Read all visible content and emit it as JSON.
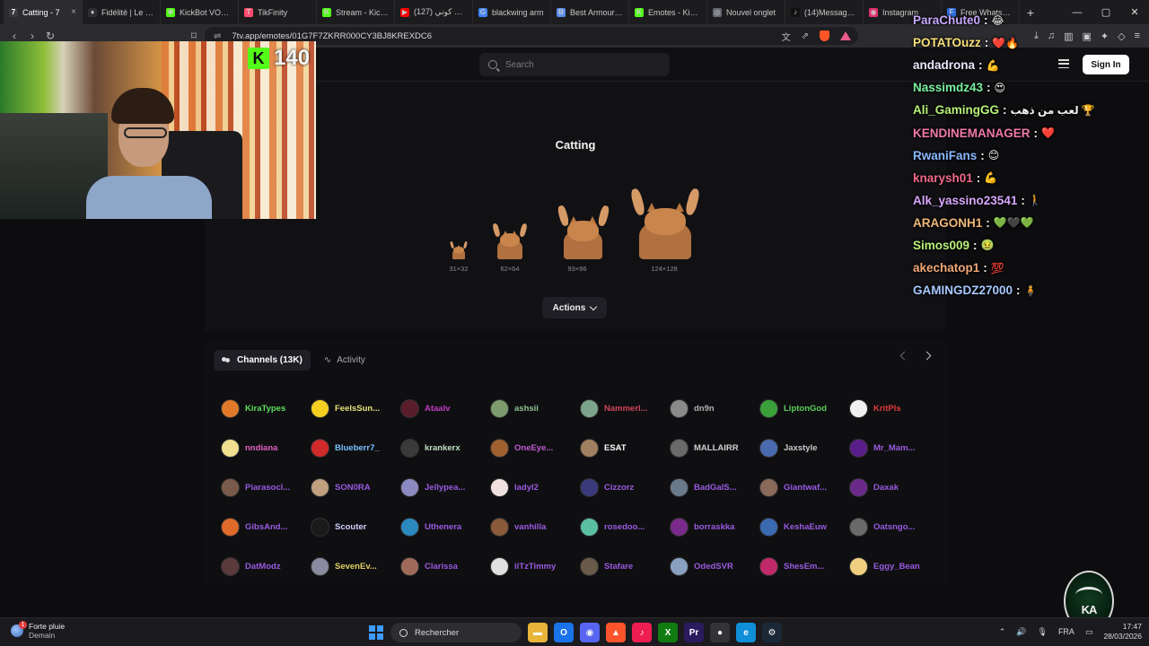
{
  "browser": {
    "tabs": [
      {
        "label": "Catting - 7",
        "color": "#3a3a3f",
        "glyph": "7"
      },
      {
        "label": "Fidélité | Le me",
        "color": "#2d2d33",
        "glyph": "♦"
      },
      {
        "label": "KickBot VOD Ed",
        "color": "#53fc18",
        "glyph": "✱"
      },
      {
        "label": "TikFinity",
        "color": "#ff4d6d",
        "glyph": "T"
      },
      {
        "label": "Stream - Kick D",
        "color": "#53fc18",
        "glyph": "K"
      },
      {
        "label": "(127) كوني كوني",
        "color": "#ff0000",
        "glyph": "▶"
      },
      {
        "label": "blackwing arm",
        "color": "#4285f4",
        "glyph": "G"
      },
      {
        "label": "Best Armour in",
        "color": "#5b8def",
        "glyph": "B"
      },
      {
        "label": "Emotes - Kick D",
        "color": "#53fc18",
        "glyph": "K"
      },
      {
        "label": "Nouvel onglet",
        "color": "#666a70",
        "glyph": "◎"
      },
      {
        "label": "(14)Messages |",
        "color": "#111111",
        "glyph": "♪"
      },
      {
        "label": "Instagram",
        "color": "#e1306c",
        "glyph": "◉"
      },
      {
        "label": "Free WhatsApp",
        "color": "#2f6fe0",
        "glyph": "F"
      }
    ],
    "active_tab_close": "×",
    "new_tab": "+",
    "url": "7tv.app/emotes/01G7F7ZKRR000CY3BJ8KREXDC6"
  },
  "site": {
    "search_placeholder": "Search",
    "signin_label": "Sign In"
  },
  "emote": {
    "title": "Catting",
    "sizes": [
      {
        "label": "31×32",
        "w": 31,
        "h": 32
      },
      {
        "label": "62×64",
        "w": 62,
        "h": 64
      },
      {
        "label": "93×96",
        "w": 93,
        "h": 96
      },
      {
        "label": "124×128",
        "w": 124,
        "h": 128
      }
    ],
    "actions_label": "Actions"
  },
  "channels": {
    "tab_channels": "Channels (13K)",
    "tab_activity": "Activity",
    "rows": [
      [
        {
          "name": "KiraTypes",
          "color": "#5ce05c",
          "av": "#e07a2a"
        },
        {
          "name": "FeelsSun...",
          "color": "#e8e07a",
          "av": "#f5d020"
        },
        {
          "name": "Ataalv",
          "color": "#c03ac0",
          "av": "#5a1e2a"
        },
        {
          "name": "ashsii",
          "color": "#8ec08e",
          "av": "#7c9c6e"
        },
        {
          "name": "Nammerl...",
          "color": "#d0455a",
          "av": "#7ca48a"
        },
        {
          "name": "dn9n",
          "color": "#b0b0b0",
          "av": "#8a8a8a"
        },
        {
          "name": "LiptonGod",
          "color": "#5cd05c",
          "av": "#3aa03a"
        },
        {
          "name": "KritPls",
          "color": "#e03a3a",
          "av": "#f0f0f0"
        }
      ],
      [
        {
          "name": "nndiana",
          "color": "#e060c0",
          "av": "#f0e090"
        },
        {
          "name": "Blueberr7_",
          "color": "#7ac0ff",
          "av": "#d02a2a"
        },
        {
          "name": "krankerx",
          "color": "#c0e0c0",
          "av": "#3a3a3a"
        },
        {
          "name": "OneEye...",
          "color": "#c05ad0",
          "av": "#a06030"
        },
        {
          "name": "ESAT",
          "color": "#ffffff",
          "av": "#a08060"
        },
        {
          "name": "MALLAIRR",
          "color": "#d0d0d0",
          "av": "#6a6a6a"
        },
        {
          "name": "Jaxstyle",
          "color": "#c8c8c8",
          "av": "#4a6ab0"
        },
        {
          "name": "Mr_Mam...",
          "color": "#9a5ae0",
          "av": "#5a1e8a"
        }
      ],
      [
        {
          "name": "Piarasocl...",
          "color": "#9a5ae0",
          "av": "#7a5a4a"
        },
        {
          "name": "SON0RA",
          "color": "#9a5ae0",
          "av": "#c0a080"
        },
        {
          "name": "Jellypea...",
          "color": "#9a5ae0",
          "av": "#8a8ac0"
        },
        {
          "name": "ladyl2",
          "color": "#9a5ae0",
          "av": "#f0e0e0"
        },
        {
          "name": "Cizzorz",
          "color": "#9a5ae0",
          "av": "#3a3a7a"
        },
        {
          "name": "BadGalS...",
          "color": "#9a5ae0",
          "av": "#6a7a8a"
        },
        {
          "name": "Giantwaf...",
          "color": "#9a5ae0",
          "av": "#8a6a5a"
        },
        {
          "name": "Daxak",
          "color": "#9a5ae0",
          "av": "#6a2a8a"
        }
      ],
      [
        {
          "name": "GibsAnd...",
          "color": "#9a5ae0",
          "av": "#e06a2a"
        },
        {
          "name": "Scouter",
          "color": "#d0d0ff",
          "av": "#1a1a1a"
        },
        {
          "name": "Uthenera",
          "color": "#9a5ae0",
          "av": "#2a8ac0"
        },
        {
          "name": "vanhilla",
          "color": "#9a5ae0",
          "av": "#8a5a3a"
        },
        {
          "name": "rosedoo...",
          "color": "#9a5ae0",
          "av": "#5ac0a0"
        },
        {
          "name": "borraskka",
          "color": "#9a5ae0",
          "av": "#7a2a8a"
        },
        {
          "name": "KeshaEuw",
          "color": "#9a5ae0",
          "av": "#3a6ab0"
        },
        {
          "name": "Oatsngo...",
          "color": "#9a5ae0",
          "av": "#6a6a6a"
        }
      ],
      [
        {
          "name": "DatModz",
          "color": "#9a5ae0",
          "av": "#5a3a3a"
        },
        {
          "name": "SevenEv...",
          "color": "#e0d060",
          "av": "#8a8aa0"
        },
        {
          "name": "Clarissa",
          "color": "#9a5ae0",
          "av": "#a06a5a"
        },
        {
          "name": "iiTzTimmy",
          "color": "#9a5ae0",
          "av": "#e0e0e0"
        },
        {
          "name": "Stafare",
          "color": "#9a5ae0",
          "av": "#6a5a4a"
        },
        {
          "name": "OdedSVR",
          "color": "#9a5ae0",
          "av": "#8aa0c0"
        },
        {
          "name": "ShesEm...",
          "color": "#9a5ae0",
          "av": "#c02a6a"
        },
        {
          "name": "Eggy_Bean",
          "color": "#9a5ae0",
          "av": "#f0d080"
        }
      ]
    ]
  },
  "stream": {
    "kick_logo": "K",
    "viewer_count": "140"
  },
  "chat": [
    {
      "user": "ParaChute0",
      "color": "#c8a8ff",
      "emote": "😂"
    },
    {
      "user": "POTATOuzz",
      "color": "#f7e07a",
      "emote": "❤️🔥"
    },
    {
      "user": "andadrona",
      "color": "#e8e8ff",
      "emote": "💪"
    },
    {
      "user": "Nassimdz43",
      "color": "#7af0a0",
      "emote": "😍"
    },
    {
      "user": "Ali_GamingGG",
      "color": "#b8f07a",
      "emote": "لعب من ذهب 🏆"
    },
    {
      "user": "KENDINEMANAGER",
      "color": "#f07aa8",
      "emote": "❤️"
    },
    {
      "user": "RwaniFans",
      "color": "#8ab8ff",
      "emote": "😊"
    },
    {
      "user": "knarysh01",
      "color": "#f06a8a",
      "emote": "💪"
    },
    {
      "user": "Alk_yassino23541",
      "color": "#d8a8ff",
      "emote": "🚶"
    },
    {
      "user": "ARAGONH1",
      "color": "#f0b878",
      "emote": "💚🖤💚"
    },
    {
      "user": "Simos009",
      "color": "#b8f07a",
      "emote": "🤢"
    },
    {
      "user": "akechatop1",
      "color": "#f0a878",
      "emote": "💯"
    },
    {
      "user": "GAMINGDZ27000",
      "color": "#a8c8ff",
      "emote": "🧍"
    }
  ],
  "taskbar": {
    "weather_title": "Forte pluie",
    "weather_sub": "Demain",
    "search_label": "Rechercher",
    "lang": "FRA",
    "time": "17:47",
    "date": "28/03/2026",
    "apps": [
      {
        "name": "files",
        "color": "#e8b43a",
        "glyph": "▬"
      },
      {
        "name": "outlook",
        "color": "#1a73e8",
        "glyph": "O"
      },
      {
        "name": "discord",
        "color": "#5865f2",
        "glyph": "◉"
      },
      {
        "name": "brave",
        "color": "#fb542b",
        "glyph": "▲"
      },
      {
        "name": "tiktok",
        "color": "#ee1d52",
        "glyph": "♪"
      },
      {
        "name": "xbox",
        "color": "#107c10",
        "glyph": "X"
      },
      {
        "name": "premiere",
        "color": "#2a1a5e",
        "glyph": "Pr"
      },
      {
        "name": "obs",
        "color": "#333336",
        "glyph": "●"
      },
      {
        "name": "edge",
        "color": "#0f8fd8",
        "glyph": "e"
      },
      {
        "name": "steam",
        "color": "#1b2838",
        "glyph": "⚙"
      }
    ]
  },
  "watermark": "KA"
}
